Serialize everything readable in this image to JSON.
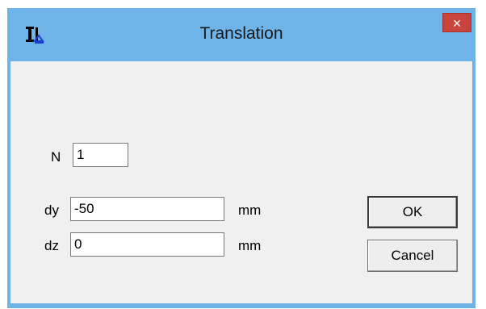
{
  "window": {
    "title": "Translation",
    "close_glyph": "×",
    "app_icon": "translation-app-icon"
  },
  "form": {
    "n_label": "N",
    "n_value": "1",
    "dy_label": "dy",
    "dy_value": "-50",
    "dy_unit": "mm",
    "dz_label": "dz",
    "dz_value": "0",
    "dz_unit": "mm"
  },
  "buttons": {
    "ok_label": "OK",
    "cancel_label": "Cancel"
  },
  "colors": {
    "titlebar": "#6fb4e8",
    "close": "#c9443c",
    "client": "#f0f0f0"
  }
}
